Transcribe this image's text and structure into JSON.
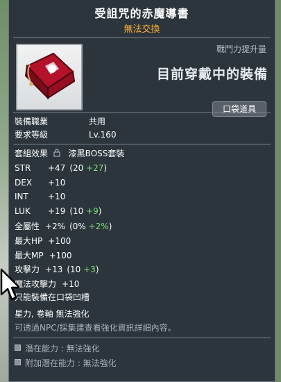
{
  "item": {
    "name": "受詛咒的赤魔導書",
    "trade_status": "無法交換",
    "power_label": "戰鬥力提升量",
    "equipped_label": "目前穿戴中的裝備",
    "pocket_badge": "口袋道具"
  },
  "info": {
    "job_label": "裝備職業",
    "job_value": "共用",
    "level_label": "要求等級",
    "level_value": "Lv.160",
    "set_label": "套組效果",
    "set_value": "漆黑BOSS套裝"
  },
  "stats": [
    {
      "label": "STR",
      "value": "+47",
      "base": "(20 ",
      "bonus": "+27",
      "close": ")"
    },
    {
      "label": "DEX",
      "value": "+10",
      "base": "",
      "bonus": "",
      "close": ""
    },
    {
      "label": "INT",
      "value": "+10",
      "base": "",
      "bonus": "",
      "close": ""
    },
    {
      "label": "LUK",
      "value": "+19",
      "base": "(10 ",
      "bonus": "+9",
      "close": ")"
    },
    {
      "label": "全屬性",
      "value": "+2%",
      "base": "(0% ",
      "bonus": "+2%",
      "close": ")"
    },
    {
      "label": "最大HP",
      "value": "+100",
      "base": "",
      "bonus": "",
      "close": ""
    },
    {
      "label": "最大MP",
      "value": "+100",
      "base": "",
      "bonus": "",
      "close": ""
    },
    {
      "label": "攻擊力",
      "value": "+13",
      "base": "(10 ",
      "bonus": "+3",
      "close": ")"
    },
    {
      "label": "魔法攻擊力",
      "value": "+10",
      "base": "",
      "bonus": "",
      "close": ""
    }
  ],
  "notes": {
    "pocket_only": "只能裝備在口袋凹槽",
    "no_enhance": "星力, 卷軸 無法強化",
    "npc_hint": "可透過NPC/採集建查看強化資訊詳細內容。"
  },
  "potential": {
    "pot_label": "潛在能力 : 無法強化",
    "add_label": "附加潛在能力 : 無法強化"
  }
}
